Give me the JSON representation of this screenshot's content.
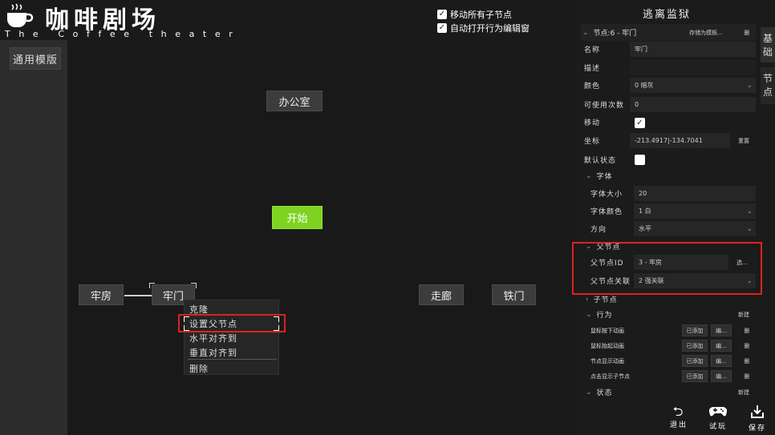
{
  "app": {
    "title": "咖啡剧场",
    "subtitle": "The Coffee theater"
  },
  "left": {
    "template_button": "通用模版"
  },
  "options": {
    "move_children": "移动所有子节点",
    "auto_open_editor": "自动打开行为编辑窗",
    "move_children_checked": true,
    "auto_open_editor_checked": true
  },
  "nodes": {
    "office": "办公室",
    "start": "开始",
    "cell": "牢房",
    "cell_door": "牢门",
    "corridor": "走廊",
    "iron_gate": "铁门"
  },
  "context_menu": {
    "clone": "克隆",
    "set_parent": "设置父节点",
    "h_align": "水平对齐到",
    "v_align": "垂直对齐到",
    "delete": "删除"
  },
  "panel": {
    "title": "逃离监狱",
    "tabs": {
      "basic": "基础",
      "nodes": "节点"
    },
    "node_header": "节点:6 - 牢门",
    "save_as_template": "存储为模板...",
    "delete_short": "删",
    "name_label": "名称",
    "name_value": "牢门",
    "desc_label": "描述",
    "color_label": "颜色",
    "color_value": "0 暗灰",
    "uses_label": "可使用次数",
    "uses_value": "0",
    "move_label": "移动",
    "coord_label": "坐标",
    "coord_value": "-213.4917|-134.7041",
    "reset": "重置",
    "default_state_label": "默认状态",
    "font_section": "字体",
    "font_size_label": "字体大小",
    "font_size_value": "20",
    "font_color_label": "字体颜色",
    "font_color_value": "1 白",
    "direction_label": "方向",
    "direction_value": "水平",
    "parent_section": "父节点",
    "parent_id_label": "父节点ID",
    "parent_id_value": "3 - 牢房",
    "parent_id_btn": "选...",
    "parent_rel_label": "父节点关联",
    "parent_rel_value": "2 强关联",
    "child_section": "子节点",
    "behavior_section": "行为",
    "new_label": "新建",
    "behaviors": [
      {
        "label": "鼠标按下动画",
        "status": "已添加",
        "edit": "编..."
      },
      {
        "label": "鼠标抬起动画",
        "status": "已添加",
        "edit": "编..."
      },
      {
        "label": "节点显示动画",
        "status": "已添加",
        "edit": "编..."
      },
      {
        "label": "点击显示子节点",
        "status": "已添加",
        "edit": "编..."
      }
    ],
    "state_section": "状态"
  },
  "footer": {
    "exit": "退出",
    "trial": "试玩",
    "save": "保存"
  }
}
